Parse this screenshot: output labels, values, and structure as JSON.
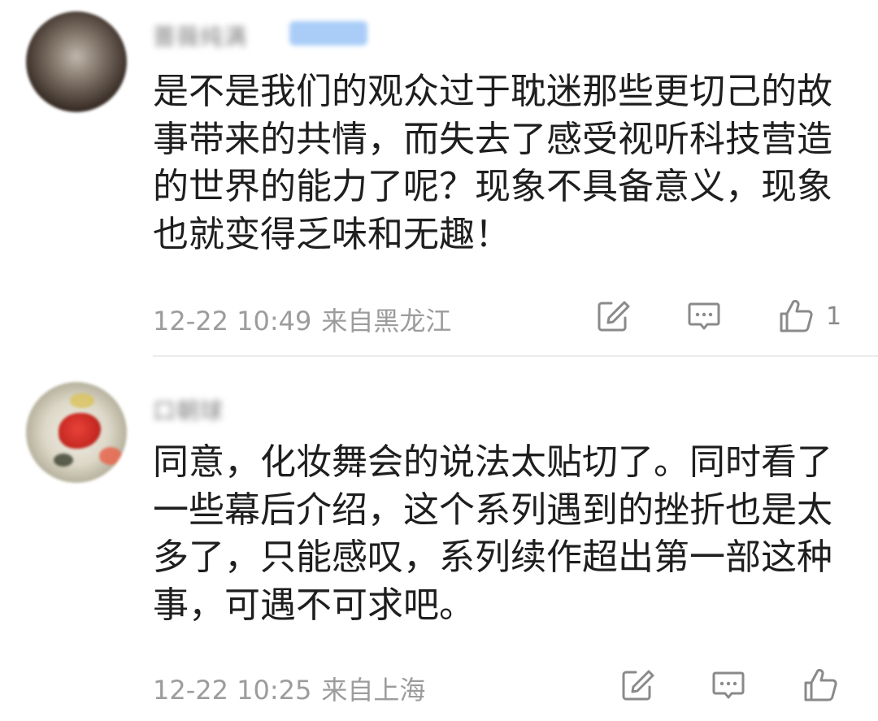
{
  "comments": [
    {
      "username": "蔷薇纯满",
      "text": "是不是我们的观众过于耽迷那些更切己的故事带来的共情，而失去了感受视听科技营造的世界的能力了呢？现象不具备意义，现象也就变得乏味和无趣！",
      "time": "12-22 10:49",
      "location": "来自黑龙江",
      "like_count": "1",
      "icons": {
        "edit": "edit-icon",
        "reply": "reply-icon",
        "like": "thumbs-up-icon"
      }
    },
    {
      "username": "口朝球",
      "text": "同意，化妆舞会的说法太贴切了。同时看了一些幕后介绍，这个系列遇到的挫折也是太多了，只能感叹，系列续作超出第一部这种事，可遇不可求吧。",
      "time": "12-22 10:25",
      "location": "来自上海",
      "like_count": "",
      "icons": {
        "edit": "edit-icon",
        "reply": "reply-icon",
        "like": "thumbs-up-icon"
      }
    }
  ],
  "colors": {
    "text": "#1e1e1e",
    "meta": "#9c9c9c",
    "icon": "#8a8a8a",
    "badge": "#a9cdf7",
    "divider": "#ececec"
  }
}
